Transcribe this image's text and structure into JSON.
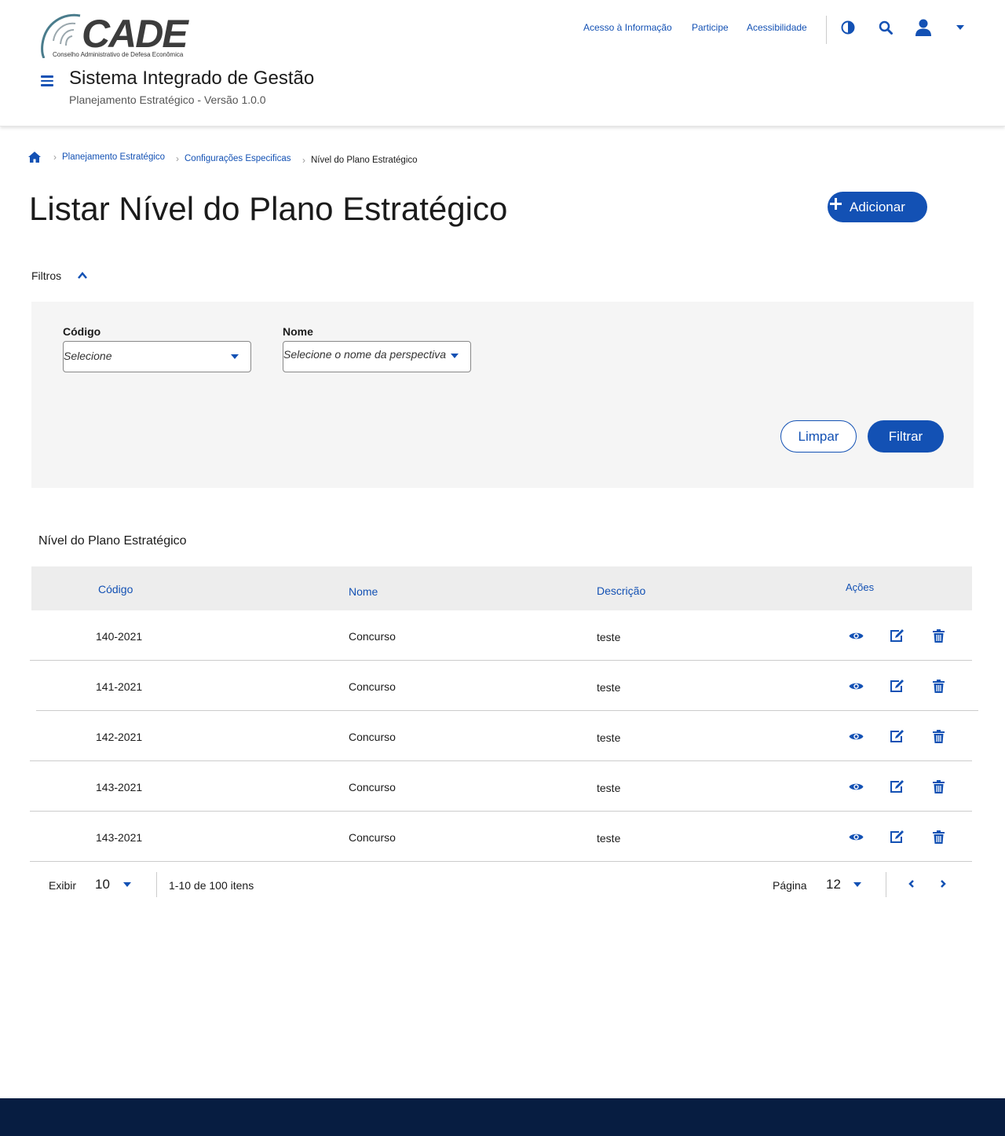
{
  "header": {
    "logo_text": "CADE",
    "logo_subtitle": "Conselho Administrativo de Defesa Econômica",
    "links": [
      "Acesso à Informação",
      "Participe",
      "Acessibilidade"
    ],
    "system_title": "Sistema Integrado de Gestão",
    "system_subtitle": "Planejamento Estratégico - Versão 1.0.0",
    "icons": [
      "contrast-icon",
      "search-icon",
      "user-icon",
      "chevron-down-icon"
    ]
  },
  "breadcrumb": {
    "items": [
      "Planejamento Estratégico",
      "Configurações Especificas",
      "Nível do Plano Estratégico"
    ]
  },
  "page": {
    "title": "Listar Nível do Plano Estratégico",
    "add_button": "Adicionar"
  },
  "filters": {
    "label": "Filtros",
    "codigo_label": "Código",
    "codigo_placeholder": "Selecione",
    "nome_label": "Nome",
    "nome_placeholder": "Selecione o nome da perspectiva",
    "clear_button": "Limpar",
    "filter_button": "Filtrar"
  },
  "table": {
    "title": "Nível do Plano Estratégico",
    "headers": [
      "Código",
      "Nome",
      "Descrição",
      "Ações"
    ],
    "rows": [
      {
        "codigo": "140-2021",
        "nome": "Concurso",
        "descricao": "teste"
      },
      {
        "codigo": "141-2021",
        "nome": "Concurso",
        "descricao": "teste"
      },
      {
        "codigo": "142-2021",
        "nome": "Concurso",
        "descricao": "teste"
      },
      {
        "codigo": "143-2021",
        "nome": "Concurso",
        "descricao": "teste"
      },
      {
        "codigo": "143-2021",
        "nome": "Concurso",
        "descricao": "teste"
      }
    ],
    "actions": [
      "view-icon",
      "edit-icon",
      "delete-icon"
    ]
  },
  "pagination": {
    "show_label": "Exibir",
    "page_size": "10",
    "range_text": "1-10 de 100 itens",
    "page_label": "Página",
    "current_page": "12"
  },
  "colors": {
    "primary": "#1351b4",
    "footer": "#071d41",
    "panel": "#f5f5f5",
    "table_header": "#ededed"
  }
}
